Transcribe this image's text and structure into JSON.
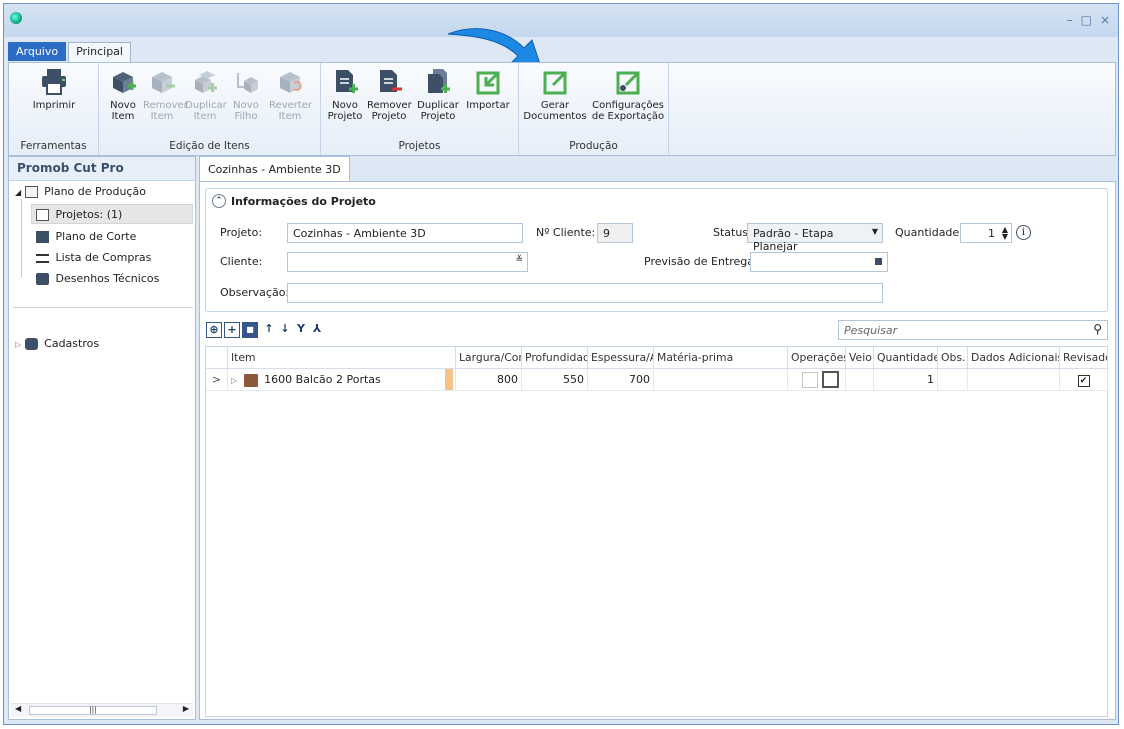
{
  "window": {
    "controls": [
      "–",
      "□",
      "×"
    ]
  },
  "tabs": {
    "arquivo": "Arquivo",
    "principal": "Principal"
  },
  "ribbon": {
    "groups": {
      "ferramentas": "Ferramentas",
      "edicao": "Edição de Itens",
      "projetos": "Projetos",
      "producao": "Produção"
    },
    "buttons": {
      "imprimir": "Imprimir",
      "novo_item": [
        "Novo",
        "Item"
      ],
      "remover_item": [
        "Remover",
        "Item"
      ],
      "duplicar_item": [
        "Duplicar",
        "Item"
      ],
      "novo_filho": [
        "Novo",
        "Filho"
      ],
      "reverter_item": [
        "Reverter",
        "Item"
      ],
      "novo_projeto": [
        "Novo",
        "Projeto"
      ],
      "remover_projeto": [
        "Remover",
        "Projeto"
      ],
      "duplicar_projeto": [
        "Duplicar",
        "Projeto"
      ],
      "importar": "Importar",
      "gerar_documentos": [
        "Gerar",
        "Documentos"
      ],
      "config_exportacao": [
        "Configurações",
        "de Exportação"
      ]
    }
  },
  "left_panel": {
    "title": "Promob Cut Pro",
    "tree": {
      "plano_producao": "Plano de Produção",
      "projetos": "Projetos: (1)",
      "plano_corte": "Plano de Corte",
      "lista_compras": "Lista de Compras",
      "desenhos": "Desenhos Técnicos",
      "cadastros": "Cadastros"
    }
  },
  "document_tab": "Cozinhas - Ambiente 3D",
  "info": {
    "title": "Informações do Projeto",
    "projeto_label": "Projeto:",
    "projeto_value": "Cozinhas - Ambiente 3D",
    "cliente_num_label": "Nº Cliente:",
    "cliente_num_value": "9",
    "status_label": "Status:",
    "status_value": "Padrão - Etapa Planejar",
    "quantidade_label": "Quantidade:",
    "quantidade_value": "1",
    "cliente_label": "Cliente:",
    "cliente_value": "",
    "previsao_label": "Previsão de Entrega:",
    "previsao_value": "",
    "observacao_label": "Observação:",
    "observacao_value": ""
  },
  "search": {
    "placeholder": "Pesquisar"
  },
  "grid": {
    "headers": {
      "item": "Item",
      "largura": "Largura/Con",
      "profundidade": "Profundidad",
      "espessura": "Espessura/A",
      "materia": "Matéria-prima",
      "operacoes": "Operações",
      "veio": "Veio",
      "quantidade": "Quantidade",
      "obs": "Obs.",
      "dados": "Dados Adicionais",
      "revisado": "Revisado"
    },
    "row": {
      "expand": ">",
      "item": "1600 Balcão 2 Portas",
      "largura": "800",
      "profundidade": "550",
      "espessura": "700",
      "quantidade": "1",
      "revisado": "✔"
    }
  },
  "colors": {
    "accent": "#2b6cc4",
    "arrow": "#1e88e5",
    "green_icon": "#4caf50"
  }
}
